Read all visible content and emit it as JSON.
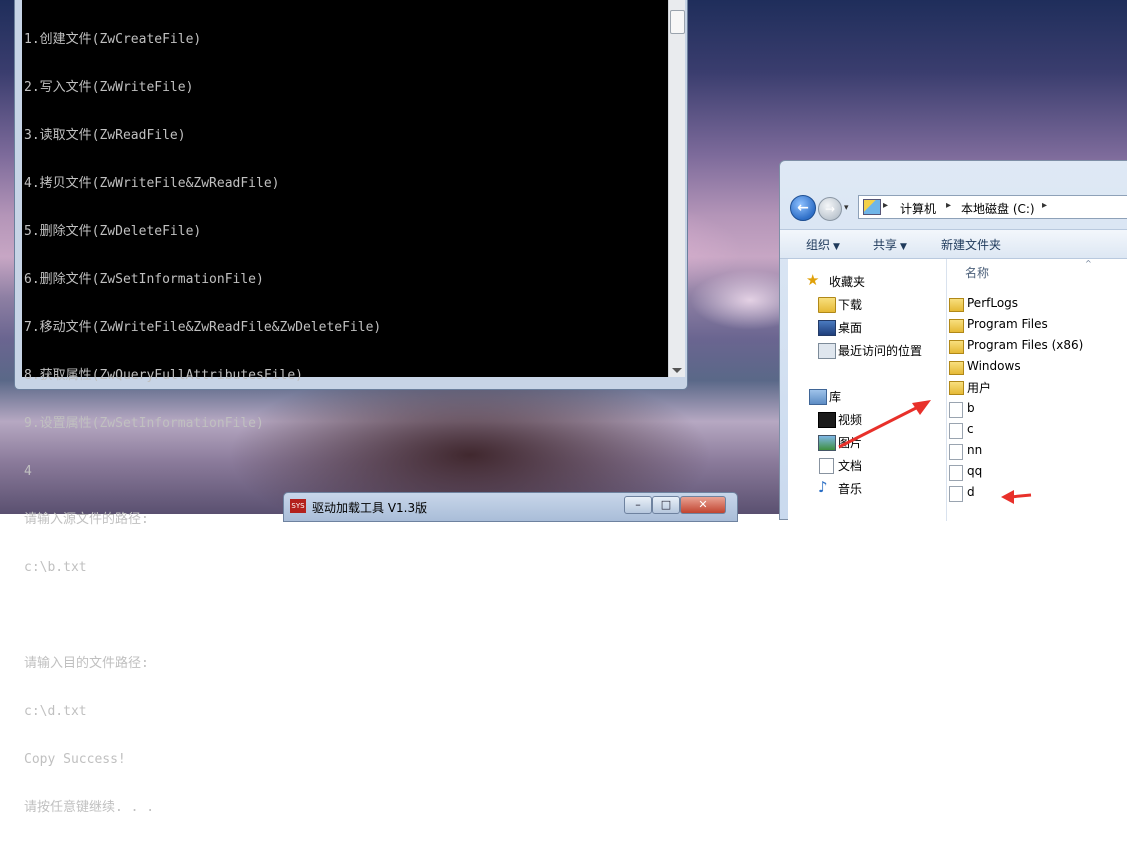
{
  "console": {
    "lines": [
      "1.创建文件(ZwCreateFile)",
      "2.写入文件(ZwWriteFile)",
      "3.读取文件(ZwReadFile)",
      "4.拷贝文件(ZwWriteFile&ZwReadFile)",
      "5.删除文件(ZwDeleteFile)",
      "6.删除文件(ZwSetInformationFile)",
      "7.移动文件(ZwWriteFile&ZwReadFile&ZwDeleteFile)",
      "8.获取属性(ZwQueryFullAttributesFile)",
      "9.设置属性(ZwSetInformationFile)",
      "4",
      "请输入源文件的路径:",
      "c:\\b.txt",
      "",
      "请输入目的文件路径:",
      "c:\\d.txt",
      "Copy Success!",
      "请按任意键继续. . ."
    ]
  },
  "explorer": {
    "address": {
      "crumbs": [
        "计算机",
        "本地磁盘 (C:)"
      ]
    },
    "toolbar": {
      "organize": "组织",
      "share": "共享",
      "new_folder": "新建文件夹"
    },
    "nav": {
      "favorites": "收藏夹",
      "downloads": "下载",
      "desktop": "桌面",
      "recent": "最近访问的位置",
      "libraries": "库",
      "videos": "视频",
      "pictures": "图片",
      "documents": "文档",
      "music": "音乐"
    },
    "column_header": "名称",
    "files": [
      {
        "name": "PerfLogs",
        "type": "folder"
      },
      {
        "name": "Program Files",
        "type": "folder"
      },
      {
        "name": "Program Files (x86)",
        "type": "folder"
      },
      {
        "name": "Windows",
        "type": "folder"
      },
      {
        "name": "用户",
        "type": "folder"
      },
      {
        "name": "b",
        "type": "file"
      },
      {
        "name": "c",
        "type": "file"
      },
      {
        "name": "nn",
        "type": "file"
      },
      {
        "name": "qq",
        "type": "file"
      },
      {
        "name": "d",
        "type": "file"
      }
    ]
  },
  "driver_window": {
    "icon_text": "SYS",
    "title": "驱动加载工具 V1.3版"
  },
  "colors": {
    "annotation_arrow": "#e8302a",
    "console_text": "#c0c0c0",
    "console_bg": "#000000"
  }
}
